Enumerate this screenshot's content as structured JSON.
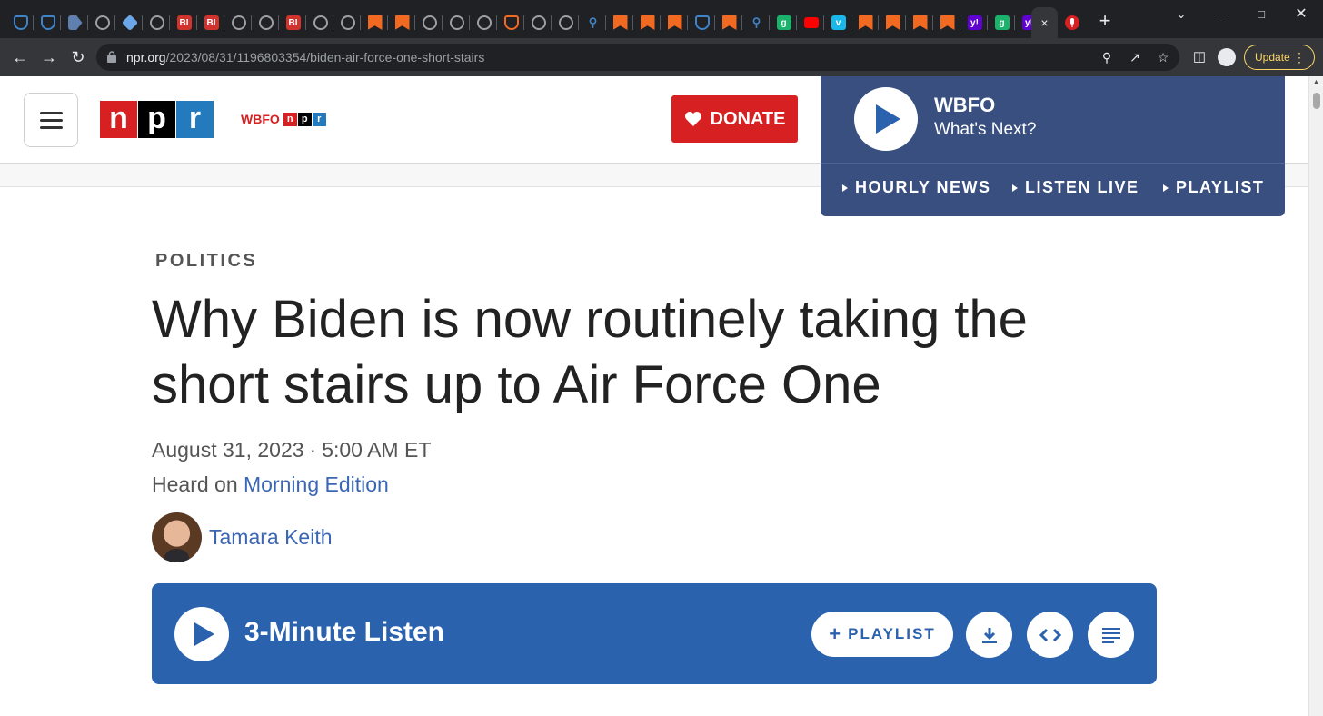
{
  "browser": {
    "tabs": [
      {
        "icon": "shield-icon",
        "color": "#3f83c8",
        "glyph": ""
      },
      {
        "icon": "shield-icon",
        "color": "#3f83c8",
        "glyph": ""
      },
      {
        "icon": "arrow-tag-icon",
        "color": "#5f7fae",
        "glyph": ""
      },
      {
        "icon": "globe-icon",
        "color": "#9aa0a6",
        "glyph": ""
      },
      {
        "icon": "gem-icon",
        "color": "#6aa6e8",
        "glyph": ""
      },
      {
        "icon": "globe-icon",
        "color": "#9aa0a6",
        "glyph": ""
      },
      {
        "icon": "bi-icon",
        "color": "#d0342c",
        "glyph": "BI"
      },
      {
        "icon": "bi-icon",
        "color": "#d0342c",
        "glyph": "BI"
      },
      {
        "icon": "globe-icon",
        "color": "#9aa0a6",
        "glyph": ""
      },
      {
        "icon": "globe-icon",
        "color": "#9aa0a6",
        "glyph": ""
      },
      {
        "icon": "bi-icon",
        "color": "#d0342c",
        "glyph": "BI"
      },
      {
        "icon": "globe-icon",
        "color": "#9aa0a6",
        "glyph": ""
      },
      {
        "icon": "globe-icon",
        "color": "#9aa0a6",
        "glyph": ""
      },
      {
        "icon": "bookmark-icon",
        "color": "#f26a21",
        "glyph": ""
      },
      {
        "icon": "bookmark-icon",
        "color": "#f26a21",
        "glyph": ""
      },
      {
        "icon": "globe-icon",
        "color": "#9aa0a6",
        "glyph": ""
      },
      {
        "icon": "globe-icon",
        "color": "#9aa0a6",
        "glyph": ""
      },
      {
        "icon": "globe-icon",
        "color": "#9aa0a6",
        "glyph": ""
      },
      {
        "icon": "shield-orange-icon",
        "color": "#f26a21",
        "glyph": ""
      },
      {
        "icon": "globe-icon",
        "color": "#9aa0a6",
        "glyph": ""
      },
      {
        "icon": "globe-icon",
        "color": "#9aa0a6",
        "glyph": ""
      },
      {
        "icon": "search-icon",
        "color": "#3f83c8",
        "glyph": ""
      },
      {
        "icon": "bookmark-icon",
        "color": "#f26a21",
        "glyph": ""
      },
      {
        "icon": "bookmark-icon",
        "color": "#f26a21",
        "glyph": ""
      },
      {
        "icon": "bookmark-icon",
        "color": "#f26a21",
        "glyph": ""
      },
      {
        "icon": "shield-icon",
        "color": "#3f83c8",
        "glyph": ""
      },
      {
        "icon": "bookmark-icon",
        "color": "#f26a21",
        "glyph": ""
      },
      {
        "icon": "search-icon",
        "color": "#3f83c8",
        "glyph": ""
      },
      {
        "icon": "g-icon",
        "color": "#1bb26b",
        "glyph": "g"
      },
      {
        "icon": "youtube-icon",
        "color": "#ff0000",
        "glyph": ""
      },
      {
        "icon": "vimeo-icon",
        "color": "#1ab7ea",
        "glyph": "v"
      },
      {
        "icon": "bookmark-icon",
        "color": "#f26a21",
        "glyph": ""
      },
      {
        "icon": "bookmark-icon",
        "color": "#f26a21",
        "glyph": ""
      },
      {
        "icon": "bookmark-icon",
        "color": "#f26a21",
        "glyph": ""
      },
      {
        "icon": "bookmark-icon",
        "color": "#f26a21",
        "glyph": ""
      },
      {
        "icon": "yahoo-icon",
        "color": "#6001d2",
        "glyph": "y!"
      },
      {
        "icon": "g-icon",
        "color": "#1bb26b",
        "glyph": "g"
      },
      {
        "icon": "yahoo-icon",
        "color": "#6001d2",
        "glyph": "y!"
      }
    ],
    "active_tab_close": "×",
    "last_tab": {
      "icon": "microphone-icon",
      "color": "#d62021"
    },
    "new_tab": "+",
    "url_host": "npr.org",
    "url_path": "/2023/08/31/1196803354/biden-air-force-one-short-stairs",
    "update_label": "Update"
  },
  "site": {
    "logo": [
      "n",
      "p",
      "r"
    ],
    "station_logo_text": "WBFO",
    "donate_label": "DONATE",
    "player": {
      "station": "WBFO",
      "subtitle": "What's Next?",
      "links": [
        "HOURLY NEWS",
        "LISTEN LIVE",
        "PLAYLIST"
      ]
    }
  },
  "article": {
    "section": "POLITICS",
    "headline": "Why Biden is now routinely taking the short stairs up to Air Force One",
    "date": "August 31, 2023",
    "time": "5:00 AM ET",
    "heard_on_prefix": "Heard on ",
    "program": "Morning Edition",
    "author": "Tamara Keith"
  },
  "audio": {
    "title": "3-Minute Listen",
    "playlist_label": "PLAYLIST"
  },
  "colors": {
    "npr_red": "#d62021",
    "npr_blue": "#237bbd",
    "player_bg": "#394f7f",
    "audio_bar": "#2b62ae",
    "link": "#3a67b5"
  }
}
